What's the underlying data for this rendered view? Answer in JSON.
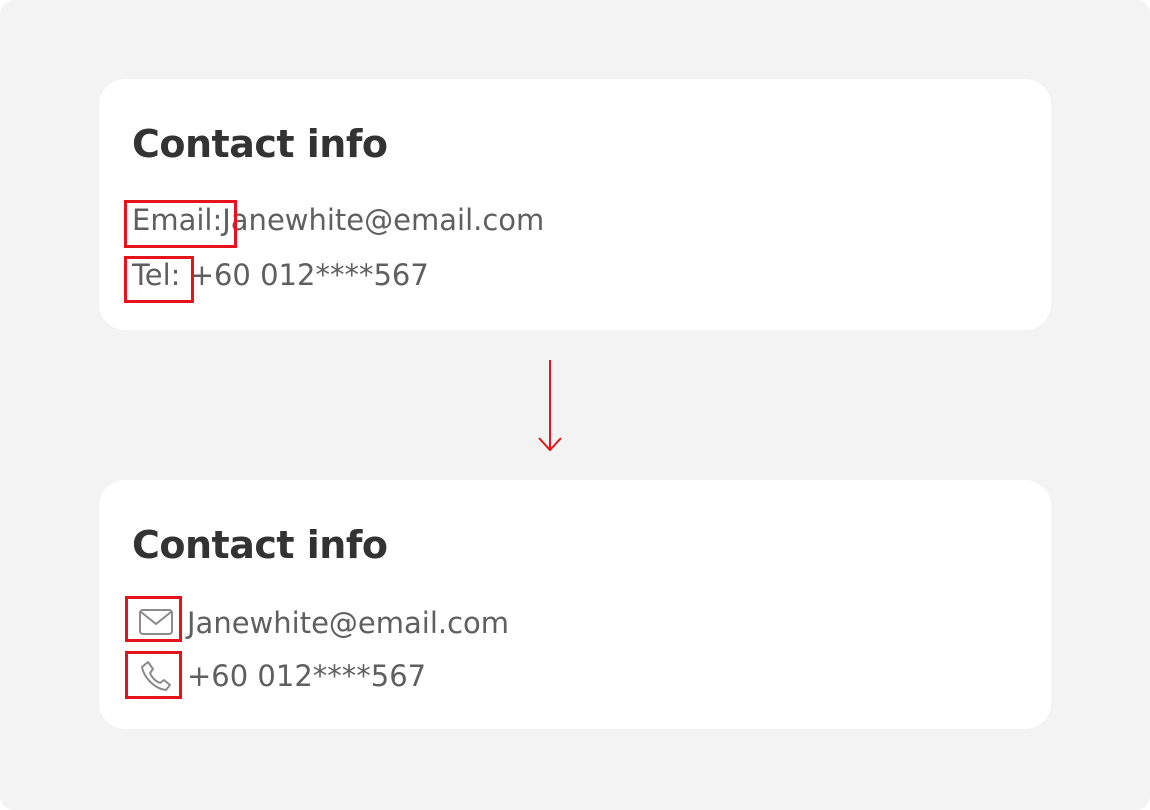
{
  "cards": [
    {
      "title": "Contact info",
      "email_label": "Email:",
      "email_value": "Janewhite@email.com",
      "tel_label": "Tel:",
      "tel_value": "+60 012****567"
    },
    {
      "title": "Contact info",
      "email_icon": "mail-icon",
      "email_value": "Janewhite@email.com",
      "tel_icon": "phone-icon",
      "tel_value": "+60 012****567"
    }
  ],
  "colors": {
    "highlight": "#e3151a",
    "background": "#f3f3f3",
    "card": "#ffffff",
    "title": "#333333",
    "text": "#5f5f5f"
  }
}
